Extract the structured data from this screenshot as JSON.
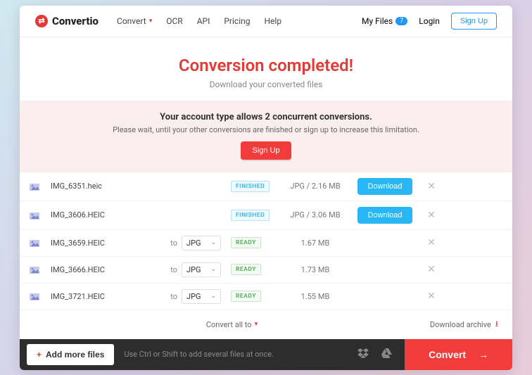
{
  "brand": {
    "name": "Convertio",
    "mark": "⇄"
  },
  "nav": {
    "items": [
      "Convert",
      "OCR",
      "API",
      "Pricing",
      "Help"
    ],
    "myfiles_label": "My Files",
    "myfiles_count": "7",
    "login_label": "Login",
    "signup_label": "Sign Up"
  },
  "hero": {
    "title": "Conversion completed!",
    "subtitle": "Download your converted files"
  },
  "notice": {
    "title": "Your account type allows 2 concurrent conversions.",
    "subtitle": "Please wait, until your other conversions are finished or sign up to increase this limitation.",
    "button": "Sign Up"
  },
  "labels": {
    "to": "to",
    "download": "Download",
    "convert_all": "Convert all to",
    "download_archive": "Download archive",
    "add_more": "Add more files",
    "hint": "Use Ctrl or Shift to add several files at once.",
    "convert": "Convert"
  },
  "files": [
    {
      "name": "IMG_6351.heic",
      "status": "FINISHED",
      "size": "JPG / 2.16 MB",
      "done": true,
      "fmt": ""
    },
    {
      "name": "IMG_3606.HEIC",
      "status": "FINISHED",
      "size": "JPG / 3.06 MB",
      "done": true,
      "fmt": ""
    },
    {
      "name": "IMG_3659.HEIC",
      "status": "READY",
      "size": "1.67 MB",
      "done": false,
      "fmt": "JPG"
    },
    {
      "name": "IMG_3666.HEIC",
      "status": "READY",
      "size": "1.73 MB",
      "done": false,
      "fmt": "JPG"
    },
    {
      "name": "IMG_3721.HEIC",
      "status": "READY",
      "size": "1.55 MB",
      "done": false,
      "fmt": "JPG"
    }
  ]
}
